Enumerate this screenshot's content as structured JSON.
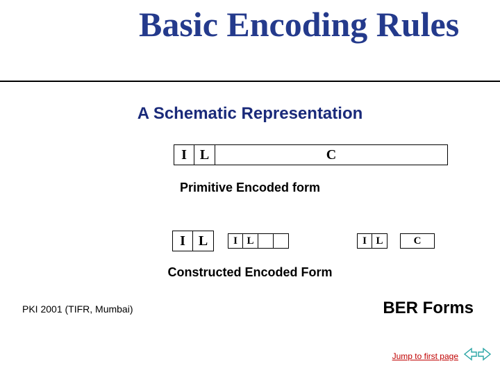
{
  "title": "Basic Encoding Rules",
  "subtitle": "A Schematic Representation",
  "diagram1": {
    "cells": [
      "I",
      "L",
      "C"
    ],
    "caption": "Primitive Encoded form"
  },
  "diagram2": {
    "outer": [
      "I",
      "L"
    ],
    "inner1": [
      "I",
      "L",
      "",
      ""
    ],
    "inner2": [
      "I",
      "L",
      "C"
    ],
    "caption": "Constructed Encoded Form"
  },
  "footer": {
    "left": "PKI 2001 (TIFR, Mumbai)",
    "right": "BER Forms"
  },
  "nav": {
    "jump_link": "Jump to first page"
  }
}
